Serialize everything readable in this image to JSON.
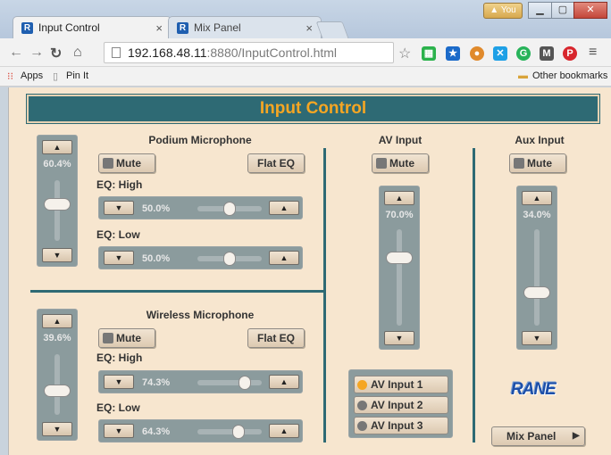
{
  "browser": {
    "tabs": [
      {
        "label": "Input Control",
        "close": "×"
      },
      {
        "label": "Mix Panel",
        "close": "×"
      }
    ],
    "user_badge": "You",
    "url_host": "192.168.48.11",
    "url_rest": ":8880/InputControl.html",
    "bookmarks": {
      "apps": "Apps",
      "pinit": "Pin It",
      "other": "Other bookmarks"
    }
  },
  "page": {
    "title": "Input Control",
    "podium": {
      "title": "Podium Microphone",
      "mute": "Mute",
      "flat_eq": "Flat EQ",
      "level": "60.4%",
      "level_fraction": 0.604,
      "eq_high_label": "EQ: High",
      "eq_high": "50.0%",
      "eq_high_fraction": 0.5,
      "eq_low_label": "EQ: Low",
      "eq_low": "50.0%",
      "eq_low_fraction": 0.5
    },
    "wireless": {
      "title": "Wireless Microphone",
      "mute": "Mute",
      "flat_eq": "Flat EQ",
      "level": "39.6%",
      "level_fraction": 0.396,
      "eq_high_label": "EQ: High",
      "eq_high": "74.3%",
      "eq_high_fraction": 0.743,
      "eq_low_label": "EQ: Low",
      "eq_low": "64.3%",
      "eq_low_fraction": 0.643
    },
    "av": {
      "title": "AV Input",
      "mute": "Mute",
      "level": "70.0%",
      "level_fraction": 0.7,
      "sources": [
        "AV Input 1",
        "AV Input 2",
        "AV Input 3"
      ],
      "active_source": "AV Input 1"
    },
    "aux": {
      "title": "Aux Input",
      "mute": "Mute",
      "level": "34.0%",
      "level_fraction": 0.34
    },
    "logo": "RANE",
    "mix_panel": "Mix Panel"
  }
}
